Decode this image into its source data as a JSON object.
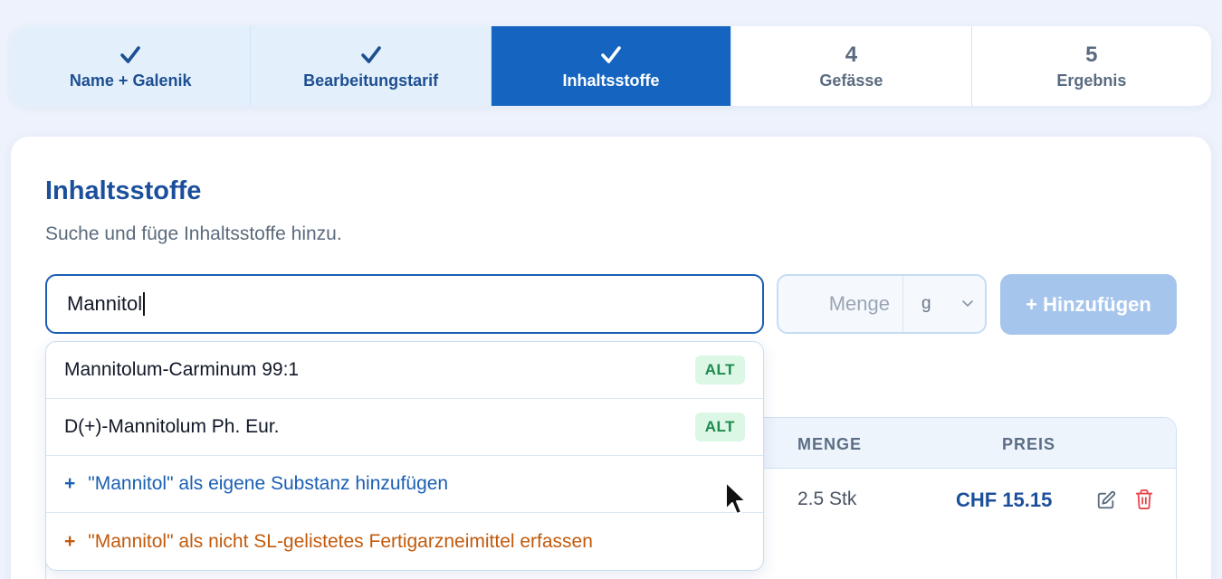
{
  "stepper": {
    "steps": [
      {
        "number": "",
        "label": "Name + Galenik",
        "state": "done"
      },
      {
        "number": "",
        "label": "Bearbeitungstarif",
        "state": "done"
      },
      {
        "number": "",
        "label": "Inhaltsstoffe",
        "state": "active"
      },
      {
        "number": "4",
        "label": "Gefässe",
        "state": "todo"
      },
      {
        "number": "5",
        "label": "Ergebnis",
        "state": "todo"
      }
    ]
  },
  "section": {
    "title": "Inhaltsstoffe",
    "subtitle": "Suche und füge Inhaltsstoffe hinzu."
  },
  "form": {
    "search_value": "Mannitol",
    "quantity_placeholder": "Menge",
    "unit_selected": "g",
    "add_label": "+ Hinzufügen"
  },
  "table": {
    "headers": {
      "menge": "MENGE",
      "preis": "PREIS"
    },
    "rows": [
      {
        "menge": "2.5 Stk",
        "preis": "CHF 15.15"
      }
    ]
  },
  "dropdown": {
    "options": [
      {
        "label": "Mannitolum-Carminum 99:1",
        "badge": "ALT"
      },
      {
        "label": "D(+)-Mannitolum Ph. Eur.",
        "badge": "ALT"
      }
    ],
    "add_custom_label": "\"Mannitol\" als eigene Substanz hinzufügen",
    "add_non_sl_label": "\"Mannitol\" als nicht SL-gelistetes Fertigarzneimittel erfassen",
    "plus_symbol": "+"
  },
  "colors": {
    "primary": "#1565c0",
    "done_bg": "#e3f0fc",
    "badge_bg": "#dcf7e6",
    "badge_text": "#1e8a4c",
    "orange": "#c25a0c",
    "delete": "#e5484d"
  }
}
